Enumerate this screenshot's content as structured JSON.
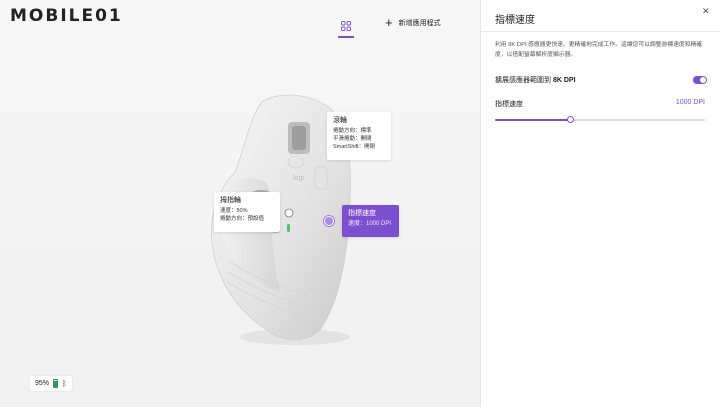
{
  "watermark": {
    "brand": "MOBILE01"
  },
  "toolbar": {
    "grid_icon": "grid-icon",
    "add_app_label": "新增應用程式",
    "add_icon": "plus-icon"
  },
  "callouts": {
    "scroll": {
      "title": "滾輪",
      "line1": "捲動方向：標準",
      "line2": "平滑捲動：開閉",
      "line3": "SmartShift：開閉"
    },
    "thumb": {
      "title": "拇指輪",
      "line1": "速度：50%",
      "line2": "捲動方向：預設值"
    },
    "pointer": {
      "title": "指標速度",
      "line1": "速度：1000 DPI"
    }
  },
  "status": {
    "battery_text": "95%",
    "battery_level": 0.95,
    "bluetooth_icon": "bluetooth-icon"
  },
  "panel": {
    "title": "指標速度",
    "description": "利用 8K DPI 感應器更快速、更精確地完成工作。這讓您可以調整游標速度和精確度，以搭配螢幕解析度顯示器。",
    "expand_label_prefix": "擴展感應器範圍到 ",
    "expand_label_bold": "8K DPI",
    "expand_enabled": true,
    "speed_label": "指標速度",
    "speed_value": "1000 DPI",
    "speed_fraction": 0.36,
    "accent_color": "#7b4fd0"
  }
}
